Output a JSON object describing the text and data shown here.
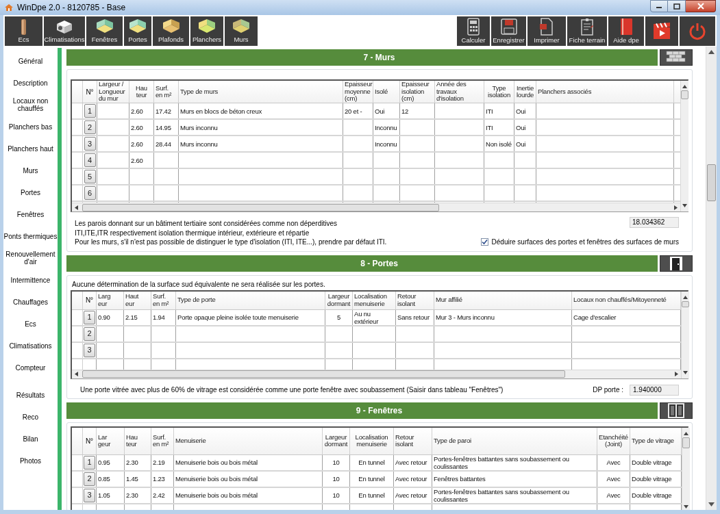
{
  "window": {
    "title": "WinDpe 2.0 - 8120785 - Base"
  },
  "toolbar": {
    "left": [
      {
        "label": "Ecs"
      },
      {
        "label": "Climatisations"
      },
      {
        "label": "Fenêtres"
      },
      {
        "label": "Portes"
      },
      {
        "label": "Plafonds"
      },
      {
        "label": "Planchers"
      },
      {
        "label": "Murs"
      }
    ],
    "right": [
      {
        "label": "Calculer"
      },
      {
        "label": "Enregistrer"
      },
      {
        "label": "Imprimer"
      },
      {
        "label": "Fiche terrain"
      },
      {
        "label": "Aide dpe"
      }
    ]
  },
  "sidebar": {
    "items": [
      {
        "label": "Général"
      },
      {
        "label": "Description"
      },
      {
        "label": "Locaux non chauffés"
      },
      {
        "label": "Planchers bas"
      },
      {
        "label": "Planchers haut"
      },
      {
        "label": "Murs"
      },
      {
        "label": "Portes"
      },
      {
        "label": "Fenêtres"
      },
      {
        "label": "Ponts thermiques"
      },
      {
        "label": "Renouvellement d'air"
      },
      {
        "label": "Intermittence"
      },
      {
        "label": "Chauffages"
      },
      {
        "label": "Ecs"
      },
      {
        "label": "Climatisations"
      },
      {
        "label": "Compteur"
      }
    ],
    "result_items": [
      {
        "label": "Résultats"
      },
      {
        "label": "Reco"
      },
      {
        "label": "Bilan"
      },
      {
        "label": "Photos"
      }
    ]
  },
  "sections": [
    {
      "title": "7 - Murs",
      "table": {
        "number_label": "N°",
        "columns": [
          "Largeur /\nLongueur\ndu mur",
          "Hau\nteur",
          "Surf.\nen m²",
          "Type de murs",
          "Epaisseur\nmoyenne\n(cm)",
          "Isolé",
          "Epaisseur\nisolation\n(cm)",
          "Année des\ntravaux\nd'isolation",
          "Type\nisolation",
          "Inertie\nlourde",
          "Planchers associés"
        ],
        "rows": [
          {
            "number": "1",
            "cells": [
              null,
              "2.60",
              "17.42",
              "Murs en blocs de béton creux",
              "20 et -",
              "Oui",
              "12",
              null,
              "ITI",
              "Oui",
              null
            ]
          },
          {
            "number": "2",
            "cells": [
              null,
              "2.60",
              "14.95",
              "Murs inconnu",
              null,
              "Inconnu",
              null,
              null,
              "ITI",
              "Oui",
              null
            ]
          },
          {
            "number": "3",
            "cells": [
              null,
              "2.60",
              "28.44",
              "Murs inconnu",
              null,
              "Inconnu",
              null,
              null,
              "Non isolé",
              "Oui",
              null
            ]
          },
          {
            "number": "4",
            "cells": [
              null,
              "2.60",
              null,
              null,
              null,
              null,
              null,
              null,
              null,
              null,
              null
            ]
          },
          {
            "number": "5",
            "cells": [
              null,
              null,
              null,
              null,
              null,
              null,
              null,
              null,
              null,
              null,
              null
            ]
          },
          {
            "number": "6",
            "cells": [
              null,
              null,
              null,
              null,
              null,
              null,
              null,
              null,
              null,
              null,
              null
            ]
          }
        ]
      },
      "notes": [
        "Les parois donnant sur un bâtiment tertiaire sont considérées comme non déperditives",
        "ITI,ITE,ITR respectivement isolation thermique intérieur, extérieure et répartie",
        "Pour les murs, s'il n'est pas possible de distinguer le type d'isolation (ITI, ITE...), prendre par défaut ITI."
      ],
      "total": "18.034362",
      "checkbox": {
        "label": "Déduire surfaces des portes et fenêtres des surfaces de murs",
        "checked": true
      }
    },
    {
      "title": "8 - Portes",
      "intro": "Aucune détermination de la surface sud équivalente ne sera réalisée sur les portes.",
      "table": {
        "number_label": "N°",
        "columns": [
          "Larg\neur",
          "Haut\neur",
          "Surf.\nen m²",
          "Type de porte",
          "Largeur\ndormant",
          "Localisation\nmenuiserie",
          "Retour\nisolant",
          "Mur affilié",
          "Locaux non chauffés/Mitoyenneté"
        ],
        "rows": [
          {
            "number": "1",
            "cells": [
              "0.90",
              "2.15",
              "1.94",
              "Porte opaque pleine isolée toute menuiserie",
              "5",
              "Au nu extérieur",
              "Sans retour",
              "Mur  3 - Murs inconnu",
              "Cage d'escalier"
            ]
          },
          {
            "number": "2",
            "cells": [
              null,
              null,
              null,
              null,
              null,
              null,
              null,
              null,
              null
            ]
          },
          {
            "number": "3",
            "cells": [
              null,
              null,
              null,
              null,
              null,
              null,
              null,
              null,
              null
            ]
          }
        ]
      },
      "footer_note": "Une porte vitrée avec plus de 60% de vitrage est considérée comme une porte fenêtre avec soubassement (Saisir dans tableau \"Fenêtres\")",
      "dp": {
        "label": "DP porte :",
        "value": "1.940000"
      }
    },
    {
      "title": "9 - Fenêtres",
      "table": {
        "number_label": "N°",
        "columns": [
          "Lar\ngeur",
          "Hau\nteur",
          "Surf.\nen m²",
          "Menuiserie",
          "Largeur\ndormant",
          "Localisation\nmenuiserie",
          "Retour\nisolant",
          "Type de paroi",
          "Etanchéité\n(Joint)",
          "Type de vitrage"
        ],
        "rows": [
          {
            "number": "1",
            "cells": [
              "0.95",
              "2.30",
              "2.19",
              "Menuiserie bois ou bois métal",
              "10",
              "En tunnel",
              "Avec retour",
              "Portes-fenêtres battantes sans soubassement ou coulissantes",
              "Avec",
              "Double vitrage"
            ]
          },
          {
            "number": "2",
            "cells": [
              "0.85",
              "1.45",
              "1.23",
              "Menuiserie bois ou bois métal",
              "10",
              "En tunnel",
              "Avec retour",
              "Fenêtres battantes",
              "Avec",
              "Double vitrage"
            ]
          },
          {
            "number": "3",
            "cells": [
              "1.05",
              "2.30",
              "2.42",
              "Menuiserie bois ou bois métal",
              "10",
              "En tunnel",
              "Avec retour",
              "Portes-fenêtres battantes sans soubassement ou coulissantes",
              "Avec",
              "Double vitrage"
            ]
          }
        ]
      }
    }
  ]
}
